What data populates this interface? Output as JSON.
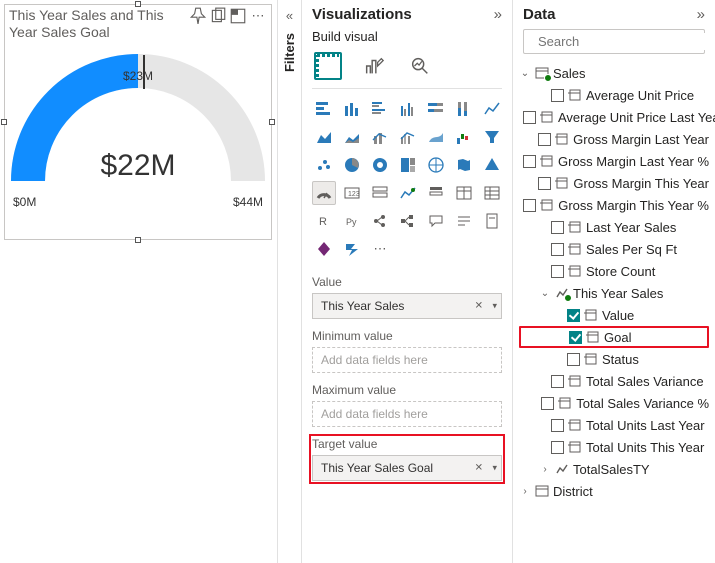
{
  "canvas": {
    "visual_title": "This Year Sales and This Year Sales Goal",
    "gauge": {
      "value_label": "$22M",
      "min_label": "$0M",
      "max_label": "$44M",
      "target_label": "$23M"
    }
  },
  "filters": {
    "label": "Filters"
  },
  "viz": {
    "title": "Visualizations",
    "build_label": "Build visual",
    "more": "⋯",
    "wells": {
      "value": {
        "label": "Value",
        "field": "This Year Sales"
      },
      "min": {
        "label": "Minimum value",
        "placeholder": "Add data fields here"
      },
      "max": {
        "label": "Maximum value",
        "placeholder": "Add data fields here"
      },
      "target": {
        "label": "Target value",
        "field": "This Year Sales Goal"
      }
    }
  },
  "data": {
    "title": "Data",
    "search_placeholder": "Search",
    "tables": {
      "sales": {
        "name": "Sales",
        "fields": [
          "Average Unit Price",
          "Average Unit Price Last Year",
          "Gross Margin Last Year",
          "Gross Margin Last Year %",
          "Gross Margin This Year",
          "Gross Margin This Year %",
          "Last Year Sales",
          "Sales Per Sq Ft",
          "Store Count"
        ],
        "kpi": {
          "name": "This Year Sales",
          "children": [
            {
              "name": "Value",
              "checked": true
            },
            {
              "name": "Goal",
              "checked": true,
              "highlight": true
            },
            {
              "name": "Status",
              "checked": false
            }
          ]
        },
        "more_fields": [
          "Total Sales Variance",
          "Total Sales Variance %",
          "Total Units Last Year",
          "Total Units This Year"
        ],
        "fx_field": "TotalSalesTY"
      },
      "district": {
        "name": "District"
      }
    }
  },
  "chart_data": {
    "type": "gauge",
    "value": 22,
    "min": 0,
    "max": 44,
    "target": 23,
    "unit": "$M",
    "title": "This Year Sales and This Year Sales Goal"
  }
}
